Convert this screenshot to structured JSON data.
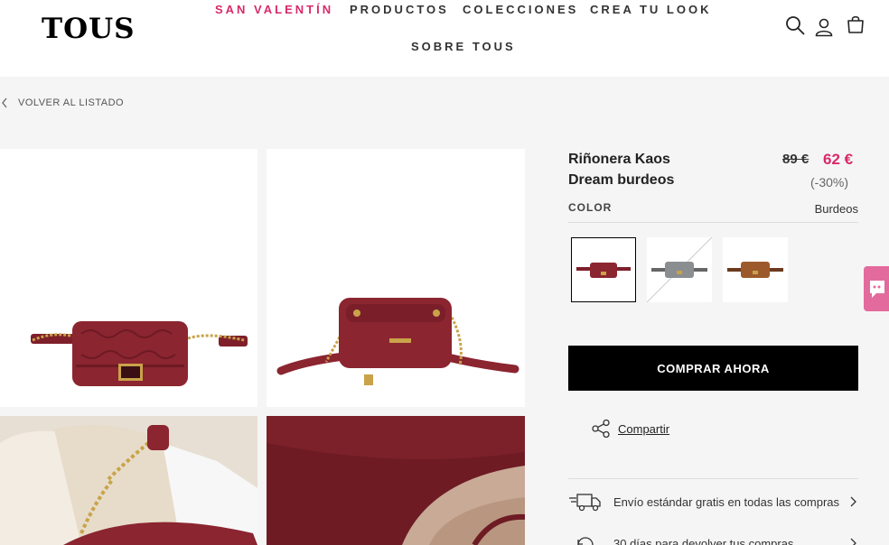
{
  "header": {
    "logo": "TOUS",
    "nav": [
      "SAN VALENTÍN",
      "PRODUCTOS",
      "COLECCIONES",
      "CREA TU LOOK",
      "SOBRE TOUS"
    ]
  },
  "breadcrumb": {
    "back_label": "VOLVER AL LISTADO"
  },
  "product": {
    "name": "Riñonera Kaos Dream burdeos",
    "old_price": "89 €",
    "new_price": "62 €",
    "discount": "(-30%)",
    "color_label": "COLOR",
    "color_value": "Burdeos",
    "swatches": [
      "burdeos",
      "gris",
      "marrón"
    ],
    "buy_label": "COMPRAR AHORA",
    "share_label": "Compartir",
    "info": [
      "Envío estándar gratis en todas las compras",
      "30 días para devolver tus compras"
    ]
  },
  "colors": {
    "accent": "#d9296a",
    "burgundy": "#8b2530",
    "gold": "#c9a24a"
  }
}
